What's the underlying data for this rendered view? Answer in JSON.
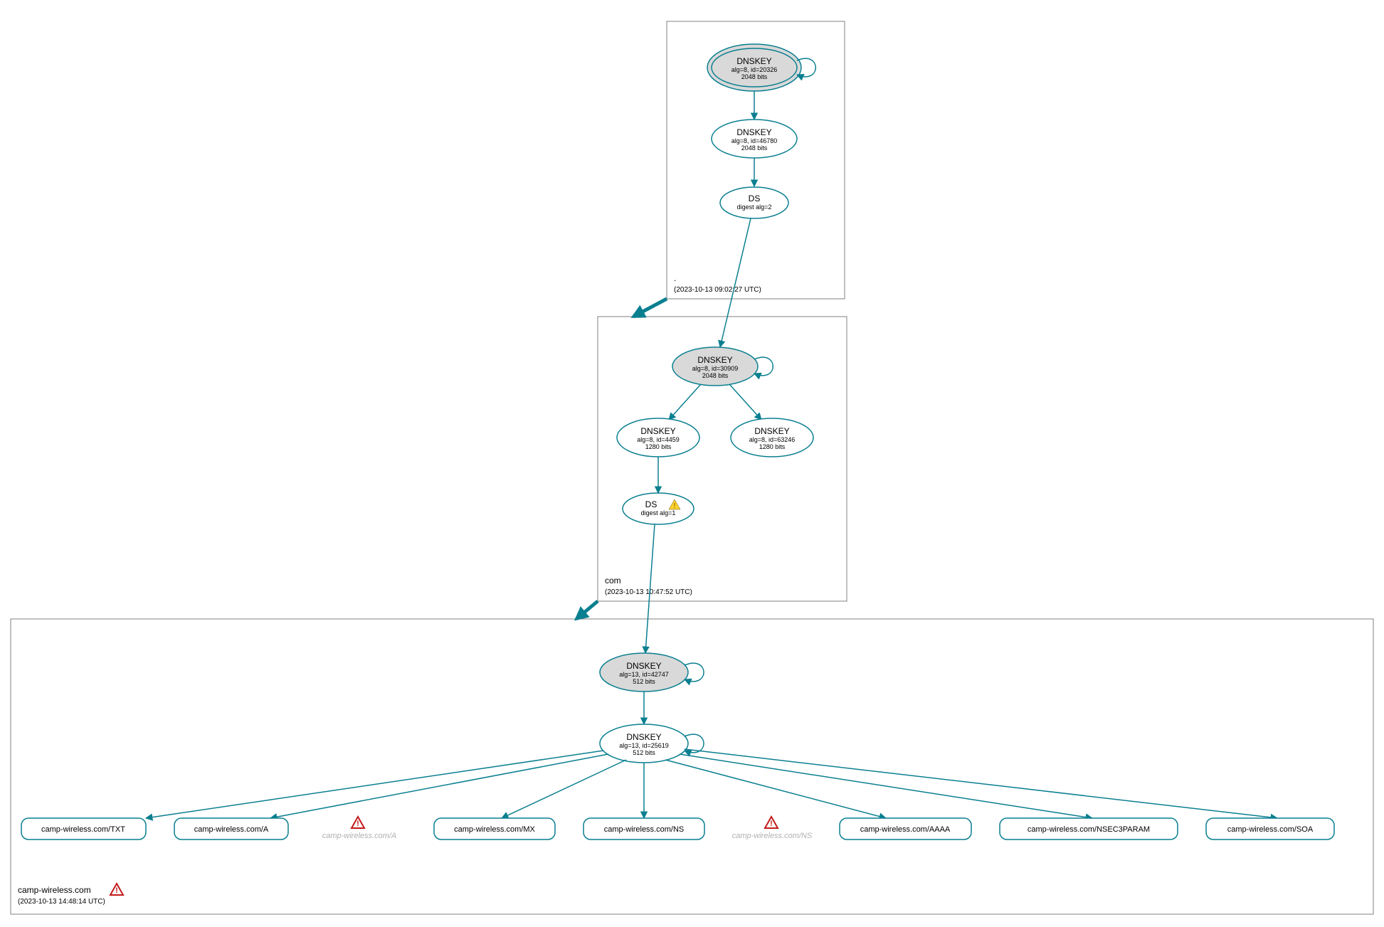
{
  "zones": {
    "root": {
      "name": ".",
      "ts": "(2023-10-13 09:02:27 UTC)"
    },
    "com": {
      "name": "com",
      "ts": "(2023-10-13 10:47:52 UTC)"
    },
    "cw": {
      "name": "camp-wireless.com",
      "ts": "(2023-10-13 14:48:14 UTC)"
    }
  },
  "nodes": {
    "root_ksk": {
      "t": "DNSKEY",
      "s1": "alg=8, id=20326",
      "s2": "2048 bits"
    },
    "root_zsk": {
      "t": "DNSKEY",
      "s1": "alg=8, id=46780",
      "s2": "2048 bits"
    },
    "root_ds": {
      "t": "DS",
      "s1": "digest alg=2"
    },
    "com_ksk": {
      "t": "DNSKEY",
      "s1": "alg=8, id=30909",
      "s2": "2048 bits"
    },
    "com_zsk1": {
      "t": "DNSKEY",
      "s1": "alg=8, id=4459",
      "s2": "1280 bits"
    },
    "com_zsk2": {
      "t": "DNSKEY",
      "s1": "alg=8, id=63246",
      "s2": "1280 bits"
    },
    "com_ds": {
      "t": "DS",
      "s1": "digest alg=1"
    },
    "cw_ksk": {
      "t": "DNSKEY",
      "s1": "alg=13, id=42747",
      "s2": "512 bits"
    },
    "cw_zsk": {
      "t": "DNSKEY",
      "s1": "alg=13, id=25619",
      "s2": "512 bits"
    }
  },
  "rr": {
    "txt": "camp-wireless.com/TXT",
    "a": "camp-wireless.com/A",
    "a2": "camp-wireless.com/A",
    "mx": "camp-wireless.com/MX",
    "ns": "camp-wireless.com/NS",
    "ns2": "camp-wireless.com/NS",
    "aaaa": "camp-wireless.com/AAAA",
    "n3p": "camp-wireless.com/NSEC3PARAM",
    "soa": "camp-wireless.com/SOA"
  }
}
